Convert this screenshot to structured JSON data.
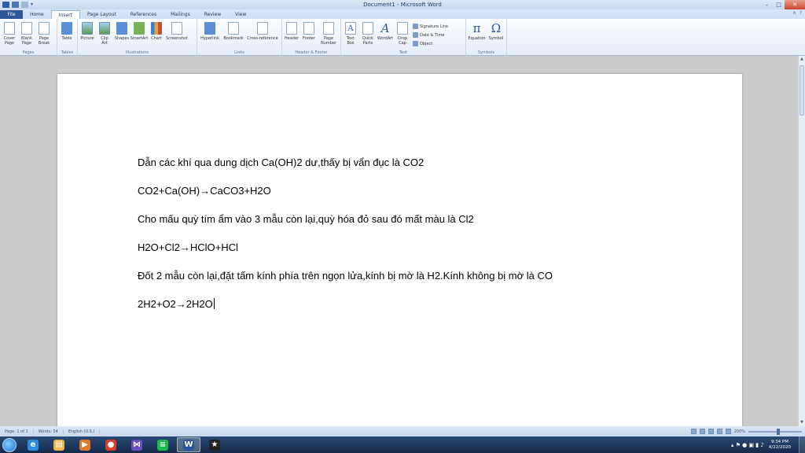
{
  "window": {
    "title": "Document1 - Microsoft Word",
    "quick_access_more": "▾",
    "minimize": "–",
    "maximize": "□",
    "close": "✕"
  },
  "tabs": [
    {
      "label": "File"
    },
    {
      "label": "Home"
    },
    {
      "label": "Insert"
    },
    {
      "label": "Page Layout"
    },
    {
      "label": "References"
    },
    {
      "label": "Mailings"
    },
    {
      "label": "Review"
    },
    {
      "label": "View"
    }
  ],
  "tab_help": {
    "collapse": "∧",
    "help": "?"
  },
  "ribbon": {
    "groups": {
      "pages": "Pages",
      "tables": "Tables",
      "illustrations": "Illustrations",
      "links": "Links",
      "header_footer": "Header & Footer",
      "text": "Text",
      "symbols": "Symbols"
    },
    "buttons": {
      "cover_page": "Cover\nPage",
      "blank_page": "Blank\nPage",
      "page_break": "Page\nBreak",
      "table": "Table",
      "picture": "Picture",
      "clip_art": "Clip\nArt",
      "shapes": "Shapes",
      "smartart": "SmartArt",
      "chart": "Chart",
      "screenshot": "Screenshot",
      "hyperlink": "Hyperlink",
      "bookmark": "Bookmark",
      "cross_reference": "Cross-reference",
      "header": "Header",
      "footer": "Footer",
      "page_number": "Page\nNumber",
      "text_box": "Text\nBox",
      "quick_parts": "Quick\nParts",
      "wordart": "WordArt",
      "drop_cap": "Drop\nCap",
      "signature_line": "Signature Line",
      "date_time": "Date & Time",
      "object": "Object",
      "equation": "Equation",
      "symbol": "Symbol"
    },
    "glyphs": {
      "equation": "π",
      "symbol": "Ω",
      "wordart": "A",
      "text_box": "A"
    }
  },
  "document": {
    "lines": [
      "Dẫn các khí qua dung dịch Ca(OH)2 dư,thấy bị vẩn đục là CO2",
      "CO2+Ca(OH)→CaCO3+H2O",
      "Cho mấu quỳ tím ẩm vào 3 mẫu còn lại,quỳ hóa đỏ sau đó mất màu là Cl2",
      "H2O+Cl2→HClO+HCl",
      "Đốt 2 mẫu còn lại,đặt tấm kính phía trên ngọn lửa,kính bị mờ là H2.Kính không bị mờ là CO",
      "2H2+O2→2H2O"
    ]
  },
  "scrollbar": {
    "up": "▲",
    "down": "▼"
  },
  "status": {
    "page": "Page: 1 of 1",
    "words": "Words: 54",
    "language": "English (U.S.)",
    "zoom": "200%",
    "zoom_fraction": 0.56
  },
  "taskbar": {
    "apps": [
      {
        "name": "internet-explorer",
        "glyph": "e",
        "color": "#2f8de0"
      },
      {
        "name": "file-explorer",
        "glyph": "▤",
        "color": "#e8b84a"
      },
      {
        "name": "media-player",
        "glyph": "▶",
        "color": "#e07a2f"
      },
      {
        "name": "chrome",
        "glyph": "●",
        "color": "#d9402b"
      },
      {
        "name": "visual-studio",
        "glyph": "⋈",
        "color": "#6a4ec0"
      },
      {
        "name": "spotify",
        "glyph": "≡",
        "color": "#1db954"
      },
      {
        "name": "word",
        "glyph": "W",
        "color": "#2b579a"
      },
      {
        "name": "star-app",
        "glyph": "★",
        "color": "#222222"
      }
    ],
    "tray_glyphs": "▴ ⚑ ● ▣ ▮ ♪",
    "time": "9:34 PM",
    "date": "4/22/2020"
  }
}
